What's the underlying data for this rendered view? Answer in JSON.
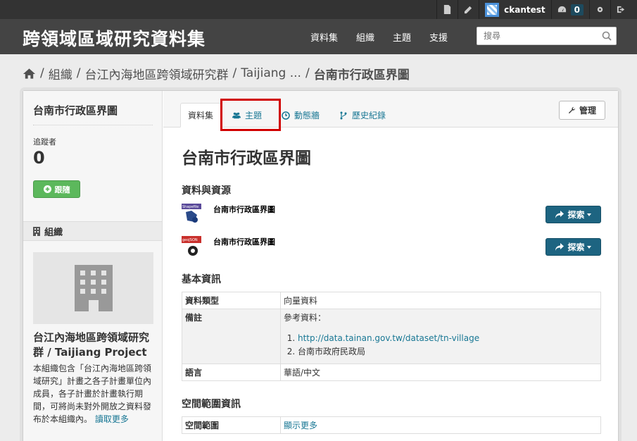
{
  "account": {
    "username": "ckantest",
    "notif_count": "0",
    "icons": [
      "file-icon",
      "pencil-icon",
      "dashboard-icon",
      "gear-icon",
      "sign-out-icon"
    ]
  },
  "site": {
    "title": "跨領域區域研究資料集",
    "nav": [
      "資料集",
      "組織",
      "主題",
      "支援"
    ],
    "search_placeholder": "搜尋"
  },
  "breadcrumb": {
    "items": [
      "組織",
      "台江內海地區跨領域研究群",
      "Taijiang ..."
    ],
    "active": "台南市行政區界圖"
  },
  "sidebar": {
    "title": "台南市行政區界圖",
    "followers_label": "追蹤者",
    "followers_count": "0",
    "follow_label": "跟隨",
    "org_header": "組織",
    "org_name": "台江內海地區跨領域研究群 / Taijiang Project",
    "org_desc": "本組織包含「台江內海地區跨領域研究」計畫之各子計畫單位內成員，各子計畫於計畫執行期間，可將尚未對外開放之資料發布於本組織內。",
    "read_more": "讀取更多"
  },
  "tabs": {
    "items": [
      "資料集",
      "主題",
      "動態牆",
      "歷史紀錄"
    ],
    "manage": "管理"
  },
  "dataset": {
    "title": "台南市行政區界圖",
    "resources_heading": "資料與資源",
    "resources": [
      {
        "name": "台南市行政區界圖",
        "format": "Shapefile",
        "explore": "探索"
      },
      {
        "name": "台南市行政區界圖",
        "format": "geoJSON",
        "explore": "探索"
      }
    ],
    "info_heading": "基本資訊",
    "info": {
      "type_key": "資料類型",
      "type_val": "向量資料",
      "note_key": "備註",
      "note_intro": "參考資料：",
      "note_items": [
        "http://data.tainan.gov.tw/dataset/tn-village",
        "台南市政府民政局"
      ],
      "lang_key": "語言",
      "lang_val": "華語/中文"
    },
    "spatial_heading": "空間範圍資訊",
    "spatial_key": "空間範圍",
    "spatial_val": "顯示更多"
  },
  "colors": {
    "accent": "#187794",
    "explore_button": "#1d6481",
    "follow_button": "#5cb85c",
    "highlight": "#d10000"
  }
}
